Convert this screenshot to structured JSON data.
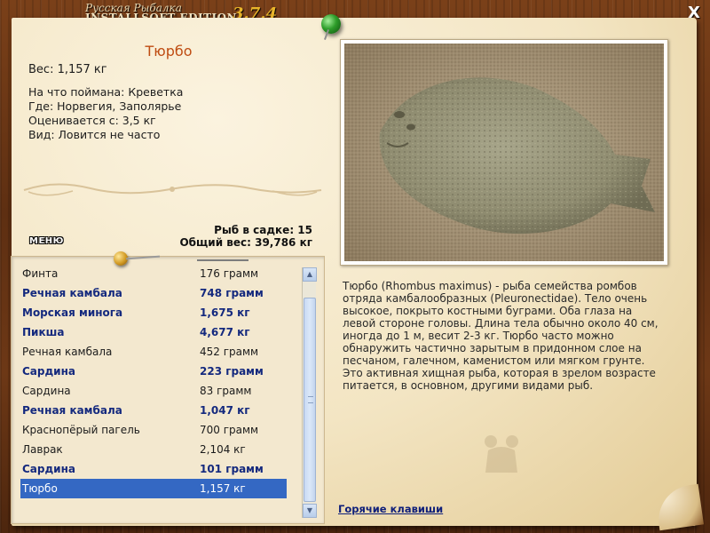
{
  "app": {
    "logo_line1": "Русская Рыбалка",
    "logo_line2": "INSTALLSOFT EDITION",
    "version": "3.7.4",
    "close_label": "X"
  },
  "fish": {
    "title": "Тюрбо",
    "weight": "Вес: 1,157 кг",
    "bait": "На что поймана: Креветка",
    "location": "Где: Норвегия, Заполярье",
    "valued_from": "Оценивается с: 3,5 кг",
    "kind": "Вид: Ловится не часто"
  },
  "menu_label": "МЕНЮ",
  "stats": {
    "count": "Рыб в садке: 15",
    "total_weight": "Общий вес: 39,786 кг"
  },
  "catch_list": [
    {
      "name": "Финта",
      "weight": "176 грамм",
      "bold": false,
      "selected": false
    },
    {
      "name": "Речная камбала",
      "weight": "748 грамм",
      "bold": true,
      "selected": false
    },
    {
      "name": "Морская минога",
      "weight": "1,675 кг",
      "bold": true,
      "selected": false
    },
    {
      "name": "Пикша",
      "weight": "4,677 кг",
      "bold": true,
      "selected": false
    },
    {
      "name": "Речная камбала",
      "weight": "452 грамм",
      "bold": false,
      "selected": false
    },
    {
      "name": "Сардина",
      "weight": "223 грамм",
      "bold": true,
      "selected": false
    },
    {
      "name": "Сардина",
      "weight": "83 грамм",
      "bold": false,
      "selected": false
    },
    {
      "name": "Речная камбала",
      "weight": "1,047 кг",
      "bold": true,
      "selected": false
    },
    {
      "name": "Краснопёрый пагель",
      "weight": "700 грамм",
      "bold": false,
      "selected": false
    },
    {
      "name": "Лаврак",
      "weight": "2,104 кг",
      "bold": false,
      "selected": false
    },
    {
      "name": "Сардина",
      "weight": "101 грамм",
      "bold": true,
      "selected": false
    },
    {
      "name": "Тюрбо",
      "weight": "1,157 кг",
      "bold": false,
      "selected": true
    }
  ],
  "description": "Тюрбо (Rhombus maximus) - рыба семейства ромбов отряда камбалообразных (Pleuronectidae). Тело очень высокое, покрыто костными буграми. Оба глаза на левой стороне головы. Длина тела обычно около 40 см, иногда до 1 м, весит 2-3 кг. Тюрбо часто можно обнаружить частично зарытым в придонном слое на песчаном, галечном, каменистом или мягком грунте. Это активная хищная рыба, которая в зрелом возрасте питается, в основном, другими видами рыб.",
  "hotkeys_label": "Горячие клавиши",
  "colors": {
    "title_accent": "#bf4c12",
    "bold_row": "#14297e",
    "selected_row": "#3468c3",
    "link": "#0f1f7a"
  }
}
